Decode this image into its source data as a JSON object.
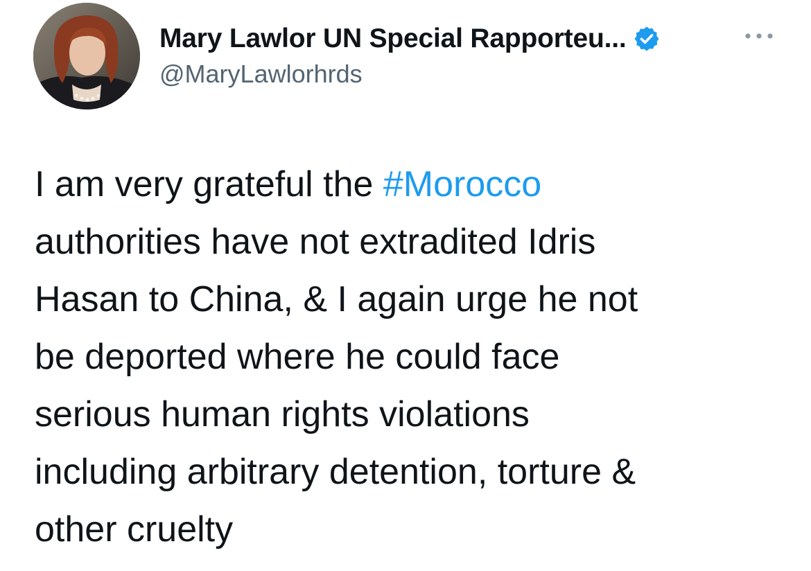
{
  "author": {
    "display_name": "Mary Lawlor UN Special Rapporteu...",
    "handle": "@MaryLawlorhrds",
    "verified": true,
    "avatar_icon": "profile-photo"
  },
  "tweet": {
    "lines": [
      {
        "before": "I am very grateful the ",
        "hashtag": "#Morocco",
        "after": ""
      },
      {
        "before": "authorities have not extradited Idris",
        "hashtag": "",
        "after": ""
      },
      {
        "before": "Hasan to China, & I again urge he not",
        "hashtag": "",
        "after": ""
      },
      {
        "before": "be deported where he could face",
        "hashtag": "",
        "after": ""
      },
      {
        "before": "serious human rights violations",
        "hashtag": "",
        "after": ""
      },
      {
        "before": "including arbitrary detention, torture &",
        "hashtag": "",
        "after": ""
      },
      {
        "before": "other cruelty",
        "hashtag": "",
        "after": ""
      }
    ]
  },
  "icons": {
    "verified": "verified-badge-icon",
    "more": "more-options-icon"
  },
  "colors": {
    "hashtag": "#1d9bf0",
    "verified_badge": "#1d9bf0",
    "handle": "#536471",
    "text": "#0f1419"
  }
}
